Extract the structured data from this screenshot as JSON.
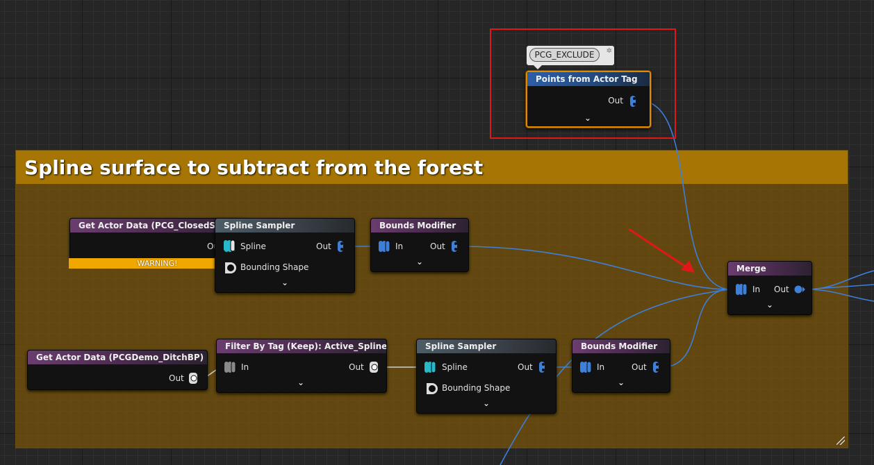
{
  "comment": {
    "title": "Spline surface to subtract from the forest"
  },
  "tag_bubble": {
    "text": "PCG_EXCLUDE",
    "pin_icon": "pin-icon"
  },
  "nodes": {
    "points_from_actor_tag": {
      "title": "Points from Actor Tag",
      "out": "Out"
    },
    "get_actor_closed_spline": {
      "title": "Get Actor Data (PCG_ClosedSpline)",
      "out": "Out",
      "warning": "WARNING!"
    },
    "spline_sampler_1": {
      "title": "Spline Sampler",
      "spline": "Spline",
      "bounding": "Bounding Shape",
      "out": "Out"
    },
    "bounds_modifier_1": {
      "title": "Bounds Modifier",
      "in": "In",
      "out": "Out"
    },
    "merge": {
      "title": "Merge",
      "in": "In",
      "out": "Out"
    },
    "get_actor_ditch": {
      "title": "Get Actor Data (PCGDemo_DitchBP)",
      "out": "Out"
    },
    "filter_by_tag": {
      "title": "Filter By Tag (Keep): Active_Spline",
      "in": "In",
      "out": "Out"
    },
    "spline_sampler_2": {
      "title": "Spline Sampler",
      "spline": "Spline",
      "bounding": "Bounding Shape",
      "out": "Out"
    },
    "bounds_modifier_2": {
      "title": "Bounds Modifier",
      "in": "In",
      "out": "Out"
    }
  },
  "colors": {
    "wire": "#3d7fd9",
    "comment_header": "#a67504",
    "selection": "#e08a00",
    "annotation": "#e01818",
    "warning": "#f0a800"
  }
}
